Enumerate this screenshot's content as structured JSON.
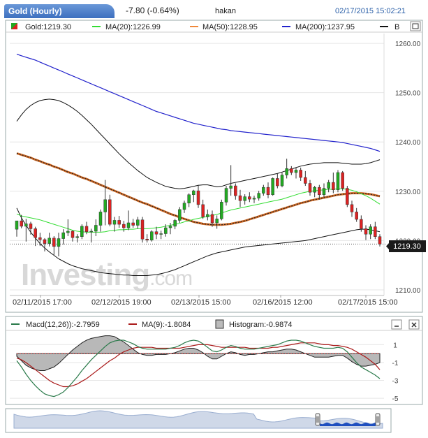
{
  "header": {
    "title": "Gold (Hourly)",
    "change": "-7.80 (-0.64%)",
    "user": "hakan",
    "datetime": "02/17/2015 15:02:21"
  },
  "legend": {
    "price": "Gold:1219.30",
    "ma20": "MA(20):1226.99",
    "ma50": "MA(50):1228.95",
    "ma200": "MA(200):1237.95",
    "bb": "B"
  },
  "macd_legend": {
    "macd": "Macd(12,26)):-2.7959",
    "signal": "MA(9):-1.8084",
    "histogram": "Histogram:-0.9874"
  },
  "watermark": {
    "main": "Investing",
    "suffix": ".com"
  },
  "price_label": "1219.30",
  "colors": {
    "up": "#22aa22",
    "down": "#dd2222",
    "ma20": "#33dd33",
    "ma50": "#cc6622",
    "ma200": "#2222cc",
    "bb": "#111111",
    "macd": "#2a7a4a",
    "signal": "#aa1a1a",
    "hist": "#999999"
  },
  "chart_data": [
    {
      "type": "candlestick",
      "x_ticks": [
        "02/11/2015 17:00",
        "02/12/2015 19:00",
        "02/13/2015 15:00",
        "02/16/2015 12:00",
        "02/17/2015 15:00"
      ],
      "y_ticks": [
        "1210.00",
        "1220.00",
        "1230.00",
        "1240.00",
        "1250.00",
        "1260.00"
      ],
      "ylim": [
        1209,
        1262
      ],
      "last_price": 1219.3,
      "candles": [
        [
          1222.3,
          1223.5,
          1220.8,
          1224.0
        ],
        [
          1224.0,
          1225.2,
          1222.5,
          1222.9
        ],
        [
          1222.9,
          1224.4,
          1219.8,
          1223.4
        ],
        [
          1223.4,
          1223.8,
          1221.2,
          1222.4
        ],
        [
          1222.4,
          1222.8,
          1218.9,
          1220.6
        ],
        [
          1220.6,
          1221.6,
          1218.9,
          1220.2
        ],
        [
          1220.2,
          1220.5,
          1217.8,
          1219.4
        ],
        [
          1219.4,
          1221.6,
          1218.8,
          1220.5
        ],
        [
          1220.5,
          1220.9,
          1217.1,
          1218.8
        ],
        [
          1218.8,
          1221.6,
          1216.8,
          1220.4
        ],
        [
          1220.4,
          1222.3,
          1219.2,
          1221.6
        ],
        [
          1221.6,
          1224.3,
          1220.9,
          1221.9
        ],
        [
          1221.9,
          1222.1,
          1219.8,
          1220.6
        ],
        [
          1220.6,
          1221.3,
          1219.6,
          1220.8
        ],
        [
          1220.8,
          1223.3,
          1220.3,
          1222.9
        ],
        [
          1222.9,
          1223.8,
          1221.3,
          1221.8
        ],
        [
          1221.8,
          1222.4,
          1219.6,
          1221.9
        ],
        [
          1221.9,
          1224.3,
          1220.9,
          1223.1
        ],
        [
          1223.1,
          1226.3,
          1221.8,
          1225.8
        ],
        [
          1225.8,
          1232.3,
          1223.1,
          1228.3
        ],
        [
          1228.3,
          1229.3,
          1222.9,
          1223.3
        ],
        [
          1223.3,
          1224.8,
          1221.8,
          1224.1
        ],
        [
          1224.1,
          1225.0,
          1222.6,
          1223.3
        ],
        [
          1223.3,
          1224.0,
          1221.8,
          1222.6
        ],
        [
          1222.6,
          1226.1,
          1222.1,
          1223.6
        ],
        [
          1223.6,
          1224.4,
          1222.6,
          1223.1
        ],
        [
          1223.1,
          1224.8,
          1222.4,
          1224.2
        ],
        [
          1224.2,
          1224.8,
          1219.6,
          1220.3
        ],
        [
          1220.3,
          1221.3,
          1219.6,
          1220.1
        ],
        [
          1220.1,
          1222.1,
          1219.8,
          1221.8
        ],
        [
          1221.8,
          1222.8,
          1220.3,
          1221.3
        ],
        [
          1221.3,
          1222.0,
          1220.3,
          1221.4
        ],
        [
          1221.4,
          1223.3,
          1220.8,
          1222.6
        ],
        [
          1222.6,
          1223.6,
          1221.3,
          1222.9
        ],
        [
          1222.9,
          1224.4,
          1222.3,
          1224.1
        ],
        [
          1224.1,
          1226.8,
          1223.6,
          1226.3
        ],
        [
          1226.3,
          1228.1,
          1225.6,
          1227.6
        ],
        [
          1227.6,
          1229.6,
          1226.8,
          1229.3
        ],
        [
          1229.3,
          1230.3,
          1227.8,
          1230.1
        ],
        [
          1230.1,
          1231.3,
          1226.6,
          1227.3
        ],
        [
          1227.3,
          1228.3,
          1224.4,
          1224.8
        ],
        [
          1224.8,
          1226.3,
          1224.1,
          1225.3
        ],
        [
          1225.3,
          1226.1,
          1222.8,
          1223.6
        ],
        [
          1223.6,
          1225.1,
          1222.4,
          1224.4
        ],
        [
          1224.4,
          1228.3,
          1224.1,
          1227.8
        ],
        [
          1227.8,
          1231.1,
          1227.1,
          1230.6
        ],
        [
          1230.6,
          1235.3,
          1229.1,
          1231.1
        ],
        [
          1231.1,
          1231.6,
          1228.3,
          1229.1
        ],
        [
          1229.1,
          1230.3,
          1226.8,
          1228.1
        ],
        [
          1228.1,
          1229.4,
          1227.3,
          1228.9
        ],
        [
          1228.9,
          1229.8,
          1227.8,
          1228.4
        ],
        [
          1228.4,
          1229.1,
          1227.6,
          1228.6
        ],
        [
          1228.6,
          1230.1,
          1228.1,
          1229.6
        ],
        [
          1229.6,
          1231.3,
          1229.1,
          1230.8
        ],
        [
          1230.8,
          1231.8,
          1228.6,
          1229.3
        ],
        [
          1229.3,
          1232.8,
          1229.1,
          1232.6
        ],
        [
          1232.6,
          1233.6,
          1230.6,
          1231.1
        ],
        [
          1231.1,
          1233.8,
          1230.8,
          1233.3
        ],
        [
          1233.3,
          1236.6,
          1232.6,
          1234.6
        ],
        [
          1234.6,
          1235.1,
          1233.3,
          1233.8
        ],
        [
          1233.8,
          1234.8,
          1232.6,
          1234.3
        ],
        [
          1234.3,
          1234.8,
          1232.1,
          1232.8
        ],
        [
          1232.8,
          1234.1,
          1231.1,
          1231.6
        ],
        [
          1231.6,
          1232.3,
          1229.1,
          1229.8
        ],
        [
          1229.8,
          1231.1,
          1228.8,
          1230.8
        ],
        [
          1230.8,
          1231.3,
          1228.3,
          1229.3
        ],
        [
          1229.3,
          1231.6,
          1228.8,
          1230.6
        ],
        [
          1230.6,
          1232.3,
          1229.8,
          1231.8
        ],
        [
          1231.8,
          1233.8,
          1229.6,
          1230.3
        ],
        [
          1230.3,
          1234.3,
          1229.8,
          1233.8
        ],
        [
          1233.8,
          1234.1,
          1230.1,
          1230.6
        ],
        [
          1230.6,
          1231.1,
          1226.8,
          1227.3
        ],
        [
          1227.3,
          1228.1,
          1224.8,
          1225.8
        ],
        [
          1225.8,
          1226.6,
          1223.8,
          1224.3
        ],
        [
          1224.3,
          1225.1,
          1221.8,
          1222.4
        ],
        [
          1222.4,
          1223.1,
          1220.1,
          1221.3
        ],
        [
          1221.3,
          1223.3,
          1220.3,
          1222.8
        ],
        [
          1222.8,
          1223.8,
          1220.3,
          1220.8
        ],
        [
          1220.8,
          1221.3,
          1218.8,
          1219.3
        ]
      ],
      "ma20": [
        1225.4,
        1225.0,
        1224.8,
        1224.6,
        1224.4,
        1224.2,
        1223.9,
        1223.6,
        1223.3,
        1223.0,
        1222.7,
        1222.4,
        1222.1,
        1221.9,
        1221.8,
        1221.7,
        1221.7,
        1221.7,
        1221.7,
        1221.8,
        1222.0,
        1222.1,
        1222.2,
        1222.2,
        1222.3,
        1222.3,
        1222.4,
        1222.4,
        1222.4,
        1222.5,
        1222.6,
        1222.7,
        1222.9,
        1223.1,
        1223.3,
        1223.5,
        1223.8,
        1224.0,
        1224.3,
        1224.5,
        1224.7,
        1224.9,
        1225.1,
        1225.3,
        1225.6,
        1225.9,
        1226.2,
        1226.4,
        1226.6,
        1226.8,
        1227.0,
        1227.2,
        1227.4,
        1227.6,
        1227.8,
        1228.0,
        1228.2,
        1228.4,
        1228.7,
        1229.0,
        1229.3,
        1229.6,
        1229.8,
        1230.0,
        1230.1,
        1230.2,
        1230.3,
        1230.4,
        1230.4,
        1230.5,
        1230.5,
        1230.4,
        1230.2,
        1229.9,
        1229.5,
        1229.1,
        1228.6,
        1228.0,
        1227.4
      ],
      "ma50": [
        1237.7,
        1237.4,
        1237.1,
        1236.8,
        1236.4,
        1236.1,
        1235.7,
        1235.4,
        1235.0,
        1234.7,
        1234.3,
        1233.9,
        1233.6,
        1233.2,
        1232.8,
        1232.5,
        1232.1,
        1231.7,
        1231.3,
        1230.9,
        1230.5,
        1230.1,
        1229.7,
        1229.3,
        1228.9,
        1228.5,
        1228.1,
        1227.7,
        1227.4,
        1227.0,
        1226.6,
        1226.2,
        1225.8,
        1225.4,
        1225.1,
        1224.7,
        1224.4,
        1224.1,
        1223.8,
        1223.6,
        1223.4,
        1223.3,
        1223.2,
        1223.2,
        1223.2,
        1223.3,
        1223.4,
        1223.6,
        1223.8,
        1224.0,
        1224.3,
        1224.6,
        1224.9,
        1225.2,
        1225.5,
        1225.8,
        1226.1,
        1226.4,
        1226.7,
        1227.0,
        1227.3,
        1227.6,
        1227.8,
        1228.1,
        1228.3,
        1228.5,
        1228.7,
        1228.9,
        1229.1,
        1229.3,
        1229.4,
        1229.5,
        1229.6,
        1229.6,
        1229.6,
        1229.5,
        1229.4,
        1229.2,
        1229.0
      ],
      "ma200": [
        1257.8,
        1257.5,
        1257.2,
        1256.9,
        1256.6,
        1256.2,
        1255.8,
        1255.4,
        1255.0,
        1254.6,
        1254.2,
        1253.8,
        1253.4,
        1253.0,
        1252.6,
        1252.2,
        1251.8,
        1251.4,
        1251.0,
        1250.6,
        1250.2,
        1249.8,
        1249.4,
        1249.0,
        1248.6,
        1248.2,
        1247.8,
        1247.4,
        1247.0,
        1246.6,
        1246.2,
        1245.9,
        1245.6,
        1245.3,
        1245.0,
        1244.7,
        1244.4,
        1244.1,
        1243.8,
        1243.6,
        1243.4,
        1243.2,
        1243.0,
        1242.8,
        1242.6,
        1242.5,
        1242.3,
        1242.2,
        1242.1,
        1242.0,
        1241.9,
        1241.8,
        1241.7,
        1241.6,
        1241.5,
        1241.4,
        1241.3,
        1241.2,
        1241.1,
        1241.0,
        1240.9,
        1240.8,
        1240.7,
        1240.6,
        1240.5,
        1240.4,
        1240.3,
        1240.2,
        1240.1,
        1240.0,
        1239.9,
        1239.7,
        1239.5,
        1239.3,
        1239.1,
        1238.9,
        1238.7,
        1238.4,
        1238.1
      ],
      "bb_upper": [
        1244.2,
        1245.5,
        1246.6,
        1247.4,
        1248.0,
        1248.4,
        1248.6,
        1248.7,
        1248.6,
        1248.4,
        1248.0,
        1247.5,
        1246.9,
        1246.2,
        1245.4,
        1244.5,
        1243.6,
        1242.6,
        1241.6,
        1240.6,
        1239.6,
        1238.6,
        1237.6,
        1236.7,
        1235.8,
        1235.0,
        1234.2,
        1233.5,
        1232.8,
        1232.3,
        1231.8,
        1231.4,
        1231.0,
        1230.8,
        1230.6,
        1230.5,
        1230.6,
        1230.8,
        1231.0,
        1231.2,
        1231.3,
        1231.3,
        1231.1,
        1230.9,
        1231.0,
        1231.3,
        1231.6,
        1231.8,
        1232.0,
        1232.2,
        1232.4,
        1232.6,
        1232.8,
        1233.0,
        1233.2,
        1233.4,
        1233.6,
        1233.9,
        1234.2,
        1234.5,
        1234.8,
        1235.1,
        1235.3,
        1235.5,
        1235.6,
        1235.7,
        1235.8,
        1235.8,
        1235.8,
        1235.8,
        1235.7,
        1235.6,
        1235.5,
        1235.5,
        1235.5,
        1235.6,
        1235.8,
        1236.1,
        1236.4
      ],
      "bb_lower": [
        1226.6,
        1224.6,
        1223.1,
        1221.7,
        1220.5,
        1219.4,
        1218.5,
        1217.7,
        1217.0,
        1216.3,
        1215.8,
        1215.3,
        1214.9,
        1214.6,
        1214.3,
        1214.1,
        1213.9,
        1213.7,
        1213.5,
        1213.4,
        1213.3,
        1213.2,
        1213.1,
        1213.0,
        1213.0,
        1212.9,
        1212.9,
        1212.9,
        1212.9,
        1213.0,
        1213.1,
        1213.3,
        1213.5,
        1213.8,
        1214.1,
        1214.5,
        1214.9,
        1215.3,
        1215.7,
        1216.1,
        1216.5,
        1216.9,
        1217.2,
        1217.5,
        1217.7,
        1217.9,
        1218.1,
        1218.3,
        1218.5,
        1218.7,
        1218.8,
        1218.9,
        1219.0,
        1219.1,
        1219.2,
        1219.3,
        1219.4,
        1219.5,
        1219.6,
        1219.7,
        1219.8,
        1219.9,
        1220.0,
        1220.2,
        1220.4,
        1220.6,
        1220.8,
        1221.0,
        1221.2,
        1221.4,
        1221.6,
        1221.8,
        1222.0,
        1222.2,
        1222.3,
        1222.3,
        1222.2,
        1222.0,
        1221.8
      ]
    },
    {
      "type": "macd",
      "y_ticks": [
        "1",
        "-1",
        "-3",
        "-5"
      ],
      "ylim": [
        -5.3,
        2.2
      ],
      "macd": [
        -0.8,
        -1.5,
        -2.3,
        -3.0,
        -3.6,
        -4.1,
        -4.5,
        -4.7,
        -4.8,
        -4.6,
        -4.3,
        -3.8,
        -3.2,
        -2.6,
        -1.9,
        -1.3,
        -0.7,
        -0.2,
        0.3,
        0.8,
        1.2,
        1.4,
        1.5,
        1.5,
        1.3,
        1.1,
        0.8,
        0.6,
        0.5,
        0.5,
        0.5,
        0.5,
        0.5,
        0.6,
        0.7,
        0.9,
        1.2,
        1.4,
        1.5,
        1.4,
        1.1,
        0.7,
        0.3,
        0.2,
        0.4,
        0.7,
        0.9,
        0.8,
        0.6,
        0.5,
        0.5,
        0.5,
        0.6,
        0.7,
        0.8,
        0.9,
        1.0,
        1.2,
        1.4,
        1.5,
        1.5,
        1.4,
        1.2,
        1.0,
        0.8,
        0.7,
        0.6,
        0.6,
        0.6,
        0.7,
        0.6,
        0.2,
        -0.4,
        -1.0,
        -1.5,
        -1.8,
        -2.1,
        -2.4,
        -2.8
      ],
      "signal": [
        -0.5,
        -0.7,
        -1.0,
        -1.4,
        -1.8,
        -2.2,
        -2.6,
        -3.0,
        -3.3,
        -3.5,
        -3.7,
        -3.7,
        -3.6,
        -3.4,
        -3.1,
        -2.8,
        -2.4,
        -2.0,
        -1.6,
        -1.2,
        -0.8,
        -0.5,
        -0.1,
        0.2,
        0.4,
        0.6,
        0.7,
        0.7,
        0.7,
        0.7,
        0.6,
        0.6,
        0.6,
        0.6,
        0.6,
        0.6,
        0.7,
        0.8,
        0.9,
        1.0,
        1.0,
        1.0,
        0.9,
        0.8,
        0.7,
        0.7,
        0.7,
        0.7,
        0.7,
        0.7,
        0.6,
        0.6,
        0.6,
        0.6,
        0.6,
        0.7,
        0.7,
        0.8,
        0.9,
        1.0,
        1.1,
        1.2,
        1.2,
        1.2,
        1.2,
        1.1,
        1.0,
        1.0,
        0.9,
        0.9,
        0.8,
        0.7,
        0.5,
        0.2,
        -0.1,
        -0.4,
        -0.8,
        -1.2,
        -1.8
      ],
      "histogram": [
        -0.3,
        -0.8,
        -1.3,
        -1.6,
        -1.8,
        -1.9,
        -1.9,
        -1.7,
        -1.5,
        -1.1,
        -0.6,
        -0.1,
        0.4,
        0.8,
        1.2,
        1.5,
        1.7,
        1.8,
        1.9,
        2.0,
        2.0,
        1.9,
        1.6,
        1.3,
        0.9,
        0.5,
        0.1,
        -0.1,
        -0.2,
        -0.2,
        -0.1,
        -0.1,
        -0.1,
        0.0,
        0.1,
        0.3,
        0.5,
        0.6,
        0.6,
        0.4,
        0.1,
        -0.3,
        -0.6,
        -0.6,
        -0.3,
        0.0,
        0.2,
        0.1,
        -0.1,
        -0.2,
        -0.1,
        -0.1,
        0.0,
        0.1,
        0.2,
        0.2,
        0.3,
        0.4,
        0.5,
        0.5,
        0.4,
        0.2,
        0.0,
        -0.2,
        -0.4,
        -0.4,
        -0.4,
        -0.4,
        -0.3,
        -0.2,
        -0.2,
        -0.5,
        -0.9,
        -1.2,
        -1.4,
        -1.4,
        -1.3,
        -1.2,
        -1.0
      ]
    }
  ]
}
